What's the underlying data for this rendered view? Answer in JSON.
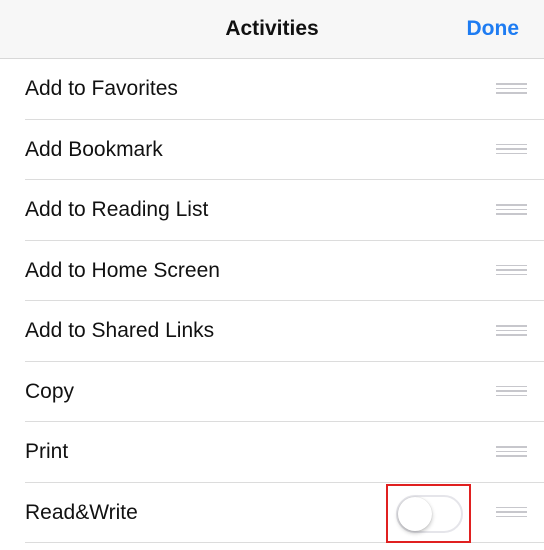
{
  "navbar": {
    "title": "Activities",
    "done_label": "Done"
  },
  "activities": [
    {
      "label": "Add to Favorites"
    },
    {
      "label": "Add Bookmark"
    },
    {
      "label": "Add to Reading List"
    },
    {
      "label": "Add to Home Screen"
    },
    {
      "label": "Add to Shared Links"
    },
    {
      "label": "Copy"
    },
    {
      "label": "Print"
    },
    {
      "label": "Read&Write",
      "toggle_on": false
    }
  ],
  "icons": {
    "reorder": "reorder-handle-icon"
  },
  "colors": {
    "accent": "#1e7cf2",
    "highlight": "#e02020",
    "separator": "#dcdcdc",
    "navbar_bg": "#f7f7f7"
  }
}
